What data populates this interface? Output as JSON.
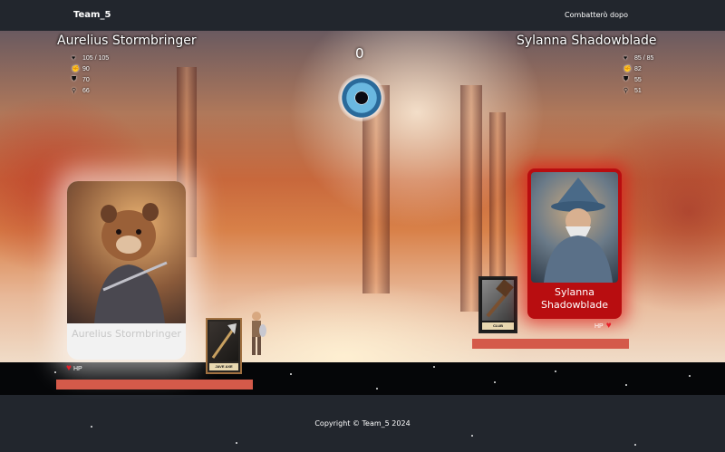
{
  "navbar": {
    "brand": "Team_5",
    "fight_later": "Combatterò dopo"
  },
  "turn": "0",
  "player_left": {
    "name": "Aurelius Stormbringer",
    "stats": {
      "hp": "105 / 105",
      "attack": "90",
      "defense": "70",
      "speed": "66"
    },
    "card_name": "Aurelius Stormbringer",
    "weapon": "JAVE AXE",
    "hp_label": "HP",
    "hp_fraction": 1.0
  },
  "player_right": {
    "name": "Sylanna Shadowblade",
    "stats": {
      "hp": "85 / 85",
      "attack": "82",
      "defense": "55",
      "speed": "51"
    },
    "card_name": "Sylanna Shadowblade",
    "weapon": "CLUB",
    "hp_label": "HP",
    "hp_fraction": 1.0
  },
  "footer": {
    "copyright": "Copyright © Team_5 2024"
  },
  "colors": {
    "hp_bar": "#d45a4a",
    "heart": "#e8202a",
    "enemy_card": "#b80d10"
  },
  "icons": {
    "hp": "heart-icon",
    "attack": "fist-icon",
    "defense": "shield-icon",
    "speed": "runner-icon"
  }
}
